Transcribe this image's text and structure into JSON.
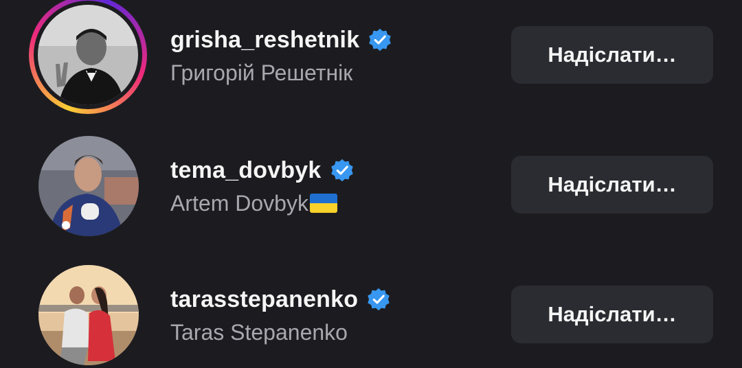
{
  "accounts": [
    {
      "username": "grisha_reshetnik",
      "full_name": "Григорій Решетнік",
      "verified": true,
      "has_story_ring": true,
      "action_label": "Надіслати…"
    },
    {
      "username": "tema_dovbyk",
      "full_name": "Artem Dovbyk",
      "flag_icon": "ukraine-flag-icon",
      "verified": true,
      "has_story_ring": false,
      "action_label": "Надіслати…"
    },
    {
      "username": "tarasstepanenko",
      "full_name": "Taras Stepanenko",
      "verified": true,
      "has_story_ring": false,
      "action_label": "Надіслати…"
    }
  ],
  "colors": {
    "background": "#1c1c20",
    "button": "#2b2c31",
    "verified_badge": "#3897f0",
    "secondary_text": "#a8a8ae"
  }
}
